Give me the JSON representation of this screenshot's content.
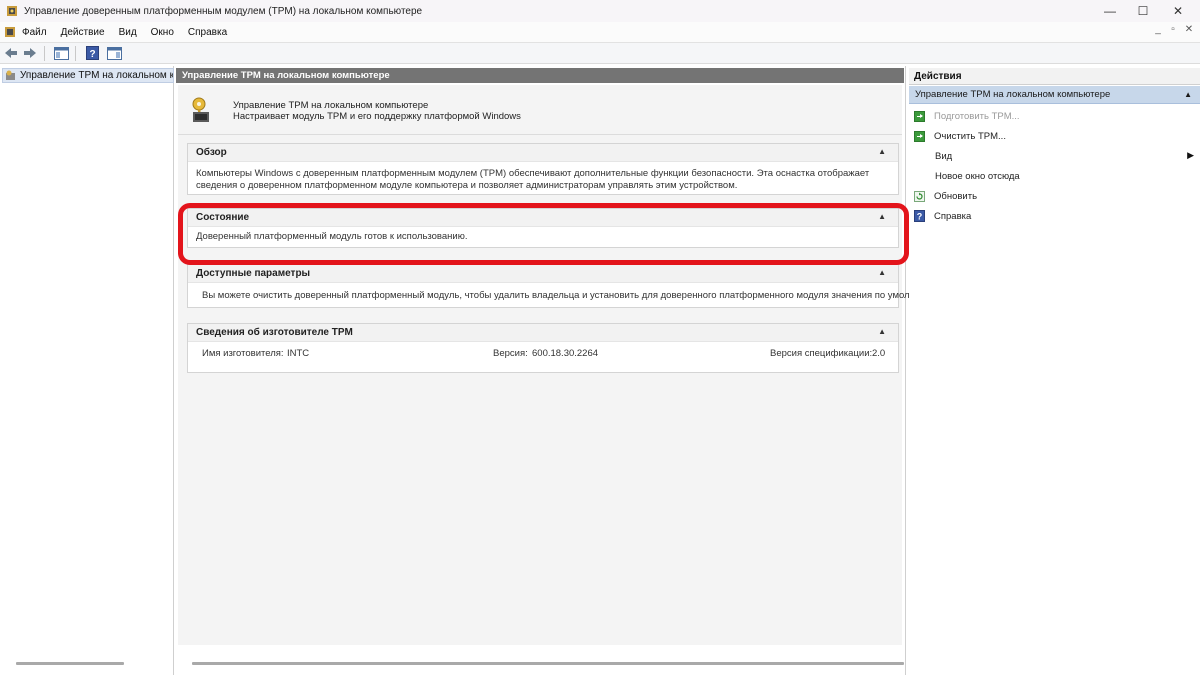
{
  "window": {
    "title": "Управление доверенным платформенным модулем (TPM) на локальном компьютере",
    "controls": {
      "minimize": "—",
      "maximize": "☐",
      "close": "✕"
    },
    "mdi_controls": {
      "minimize": "_",
      "restore": "▫",
      "close": "✕"
    }
  },
  "menu": {
    "items": [
      "Файл",
      "Действие",
      "Вид",
      "Окно",
      "Справка"
    ]
  },
  "toolbar": {
    "icons": [
      "back-arrow-icon",
      "forward-arrow-icon",
      "console-tree-icon",
      "help-icon",
      "action-pane-icon"
    ]
  },
  "tree": {
    "root_label": "Управление TPM на локальном к"
  },
  "center": {
    "header": "Управление TPM на локальном компьютере",
    "intro_line1": "Управление TPM на локальном компьютере",
    "intro_line2": "Настраивает модуль TPM и его поддержку платформой Windows",
    "sections": {
      "overview": {
        "title": "Обзор",
        "body": "Компьютеры Windows с доверенным платформенным модулем (TPM) обеспечивают дополнительные функции безопасности. Эта оснастка отображает сведения о доверенном платформенном модуле компьютера и позволяет администраторам управлять этим устройством."
      },
      "status": {
        "title": "Состояние",
        "body": "Доверенный платформенный модуль готов к использованию."
      },
      "options": {
        "title": "Доступные параметры",
        "body": "Вы можете очистить доверенный платформенный модуль, чтобы удалить владельца и установить для доверенного платформенного модуля значения по умолчанию."
      },
      "manufacturer": {
        "title": "Сведения об изготовителе TPM",
        "name_label": "Имя изготовителя:",
        "name_value": "INTC",
        "version_label": "Версия:",
        "version_value": "600.18.30.2264",
        "spec_label": "Версия спецификации:",
        "spec_value": "2.0"
      }
    }
  },
  "actions": {
    "title": "Действия",
    "subheader": "Управление TPM на локальном компьютере",
    "items": [
      {
        "label": "Подготовить TPM...",
        "icon": "green-arrow-icon",
        "enabled": false
      },
      {
        "label": "Очистить TPM...",
        "icon": "green-arrow-icon",
        "enabled": true
      },
      {
        "label": "Вид",
        "icon": "",
        "enabled": true,
        "submenu": true
      },
      {
        "label": "Новое окно отсюда",
        "icon": "",
        "enabled": true
      },
      {
        "label": "Обновить",
        "icon": "refresh-icon",
        "enabled": true
      },
      {
        "label": "Справка",
        "icon": "help-icon",
        "enabled": true
      }
    ]
  },
  "colors": {
    "highlight": "#e3141b",
    "pane_header": "#747474",
    "action_selected": "#c7d7ea"
  }
}
